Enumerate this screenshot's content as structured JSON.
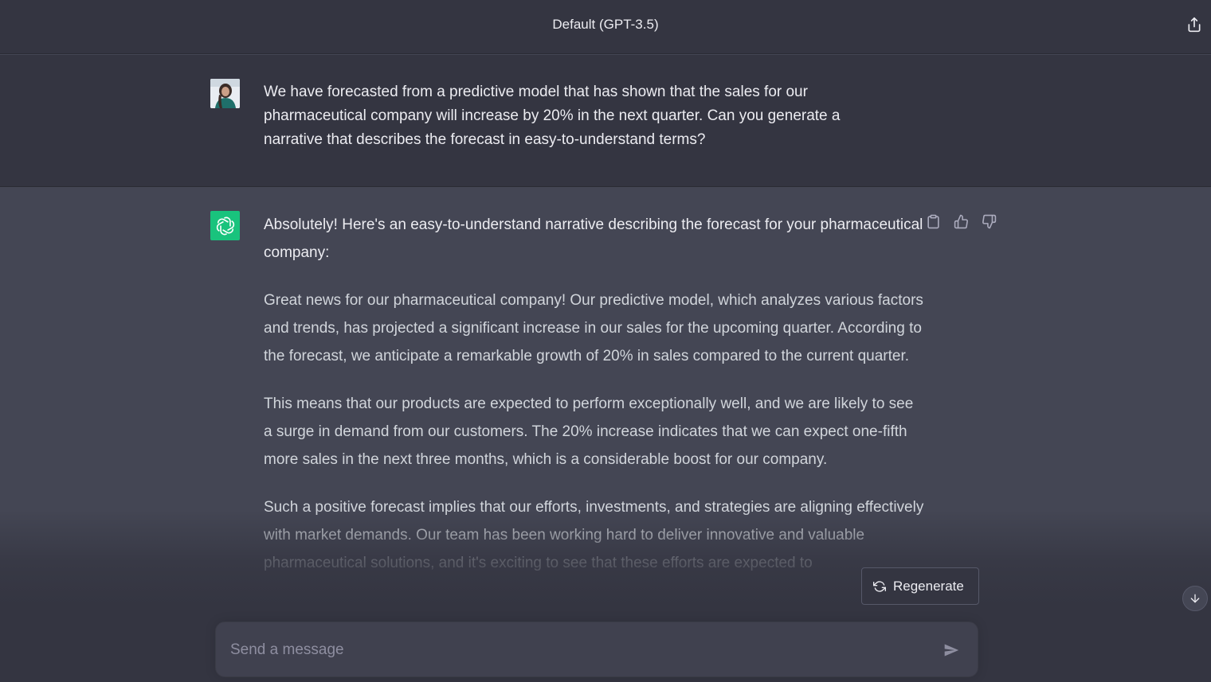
{
  "header": {
    "title": "Default (GPT-3.5)",
    "share_icon": "share-icon"
  },
  "user_message": {
    "avatar": "user-avatar",
    "text": "We have forecasted from a predictive model that has shown that the sales for our pharmaceutical company will increase by 20% in the next quarter. Can you generate a narrative that describes the forecast in easy-to-understand terms?"
  },
  "assistant_message": {
    "avatar": "chatgpt-logo-icon",
    "paragraphs": [
      "Absolutely! Here's an easy-to-understand narrative describing the forecast for your pharmaceutical company:",
      "Great news for our pharmaceutical company! Our predictive model, which analyzes various factors and trends, has projected a significant increase in our sales for the upcoming quarter. According to the forecast, we anticipate a remarkable growth of 20% in sales compared to the current quarter.",
      "This means that our products are expected to perform exceptionally well, and we are likely to see a surge in demand from our customers. The 20% increase indicates that we can expect one-fifth more sales in the next three months, which is a considerable boost for our company.",
      "Such a positive forecast implies that our efforts, investments, and strategies are aligning effectively with market demands. Our team has been working hard to deliver innovative and valuable pharmaceutical solutions, and it's exciting to see that these efforts are expected to"
    ],
    "actions": [
      "clipboard-icon",
      "thumbs-up-icon",
      "thumbs-down-icon"
    ]
  },
  "regenerate": {
    "label": "Regenerate",
    "icon": "refresh-icon"
  },
  "composer": {
    "placeholder": "Send a message",
    "value": "",
    "send_icon": "send-icon"
  },
  "scroll_down_icon": "arrow-down-icon",
  "colors": {
    "header_bg": "#343541",
    "assistant_bg": "#444654",
    "bot_avatar": "#19c37d",
    "input_bg": "#40414f"
  }
}
